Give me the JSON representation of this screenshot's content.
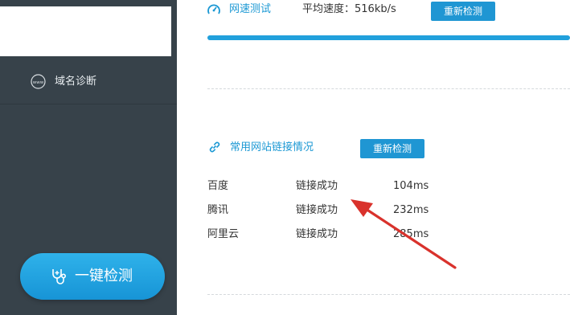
{
  "sidebar": {
    "items": [
      {
        "label": "域名诊断",
        "icon": "www-globe-icon"
      }
    ],
    "check_button": {
      "label": "一键检测",
      "icon": "stethoscope-icon"
    }
  },
  "speed_test": {
    "title": "网速测试",
    "icon": "speedometer-icon",
    "speed_label": "平均速度：516kb/s",
    "recheck_label": "重新检测",
    "progress_percent": 100
  },
  "site_check": {
    "title": "常用网站链接情况",
    "icon": "link-icon",
    "recheck_label": "重新检测",
    "rows": [
      {
        "name": "百度",
        "status": "链接成功",
        "time": "104ms"
      },
      {
        "name": "腾讯",
        "status": "链接成功",
        "time": "232ms"
      },
      {
        "name": "阿里云",
        "status": "链接成功",
        "time": "285ms"
      }
    ]
  },
  "colors": {
    "sidebar_bg": "#37424a",
    "accent": "#1d99d4",
    "button_blue": "#1f96d3",
    "annotation_arrow": "#d9322c"
  }
}
